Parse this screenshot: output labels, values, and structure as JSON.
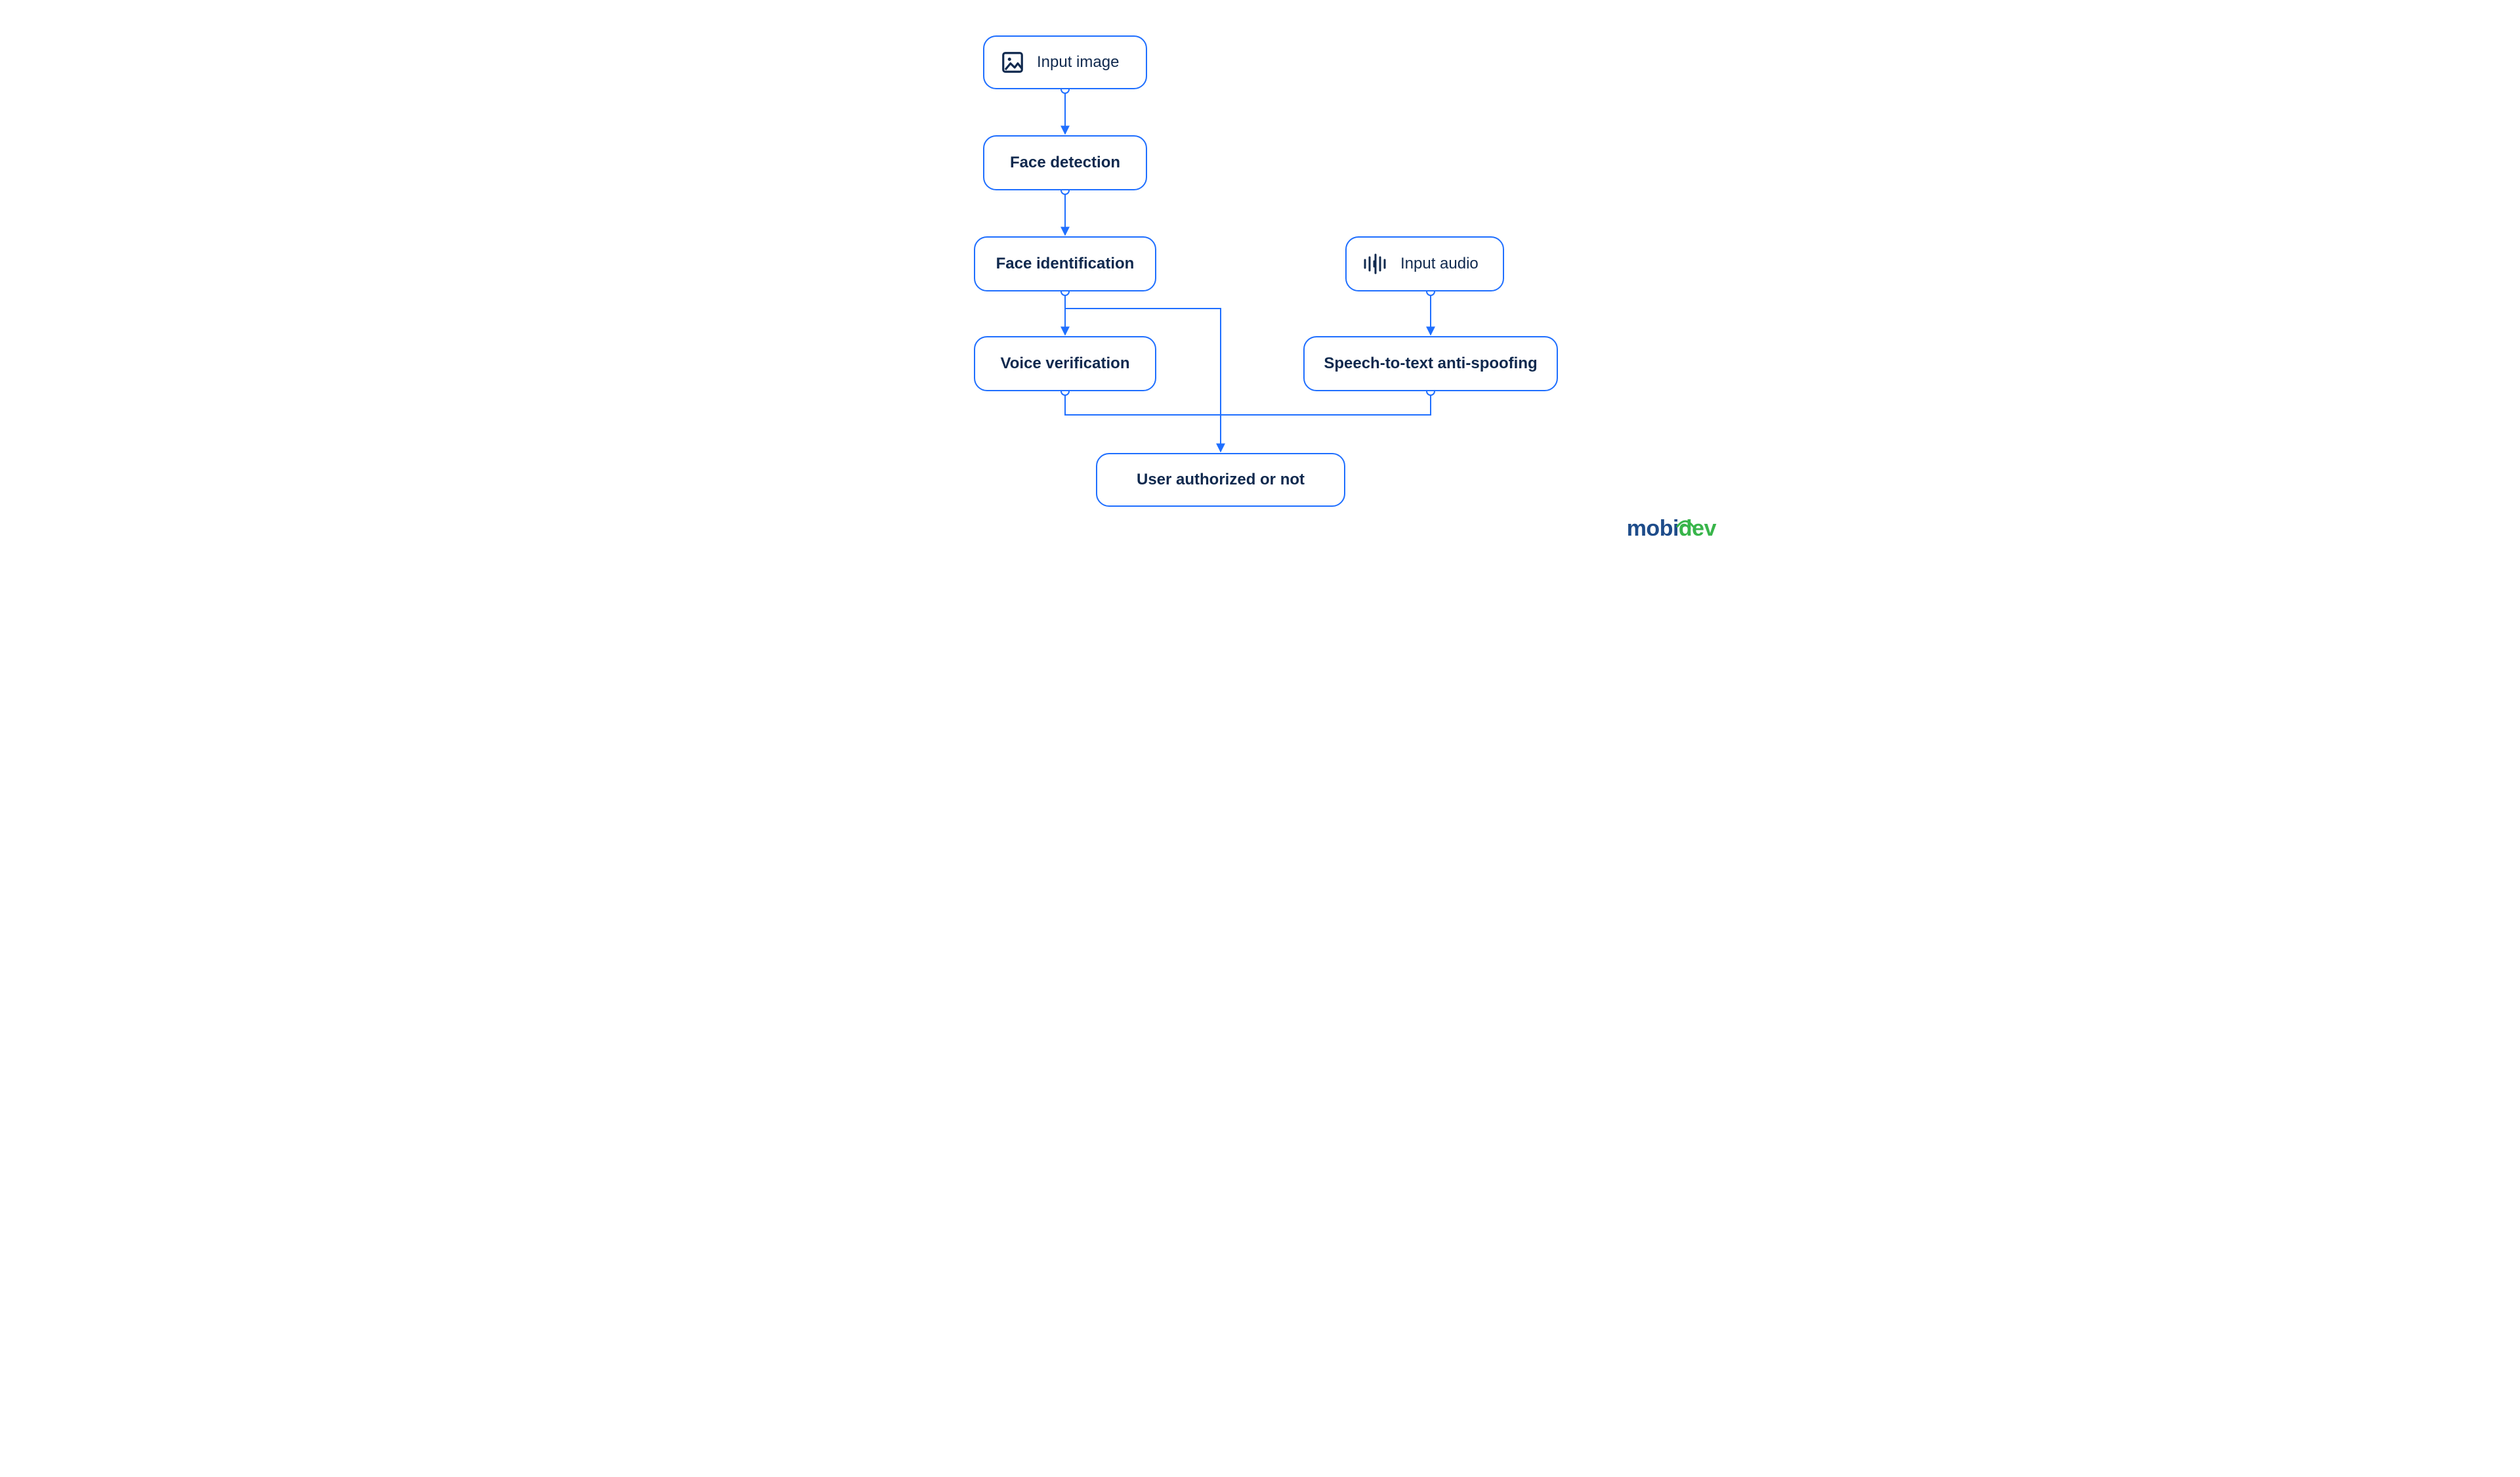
{
  "diagram": {
    "nodes": {
      "input_image": {
        "label": "Input image",
        "icon": "image-icon"
      },
      "face_detection": {
        "label": "Face detection"
      },
      "face_identification": {
        "label": "Face identification"
      },
      "input_audio": {
        "label": "Input audio",
        "icon": "audio-wave-icon"
      },
      "voice_verification": {
        "label": "Voice verification"
      },
      "anti_spoofing": {
        "label": "Speech-to-text anti-spoofing"
      },
      "result": {
        "label": "User authorized or not"
      }
    },
    "edges": [
      {
        "from": "input_image",
        "to": "face_detection"
      },
      {
        "from": "face_detection",
        "to": "face_identification"
      },
      {
        "from": "face_identification",
        "to": "voice_verification"
      },
      {
        "from": "face_identification",
        "to": "result"
      },
      {
        "from": "input_audio",
        "to": "anti_spoofing"
      },
      {
        "from": "voice_verification",
        "to": "result"
      },
      {
        "from": "anti_spoofing",
        "to": "result"
      }
    ]
  },
  "colors": {
    "node_border": "#1F6FFF",
    "text": "#10294E",
    "edge": "#1F6FFF"
  },
  "logo": {
    "part1": "mobi",
    "part2": "dev"
  }
}
